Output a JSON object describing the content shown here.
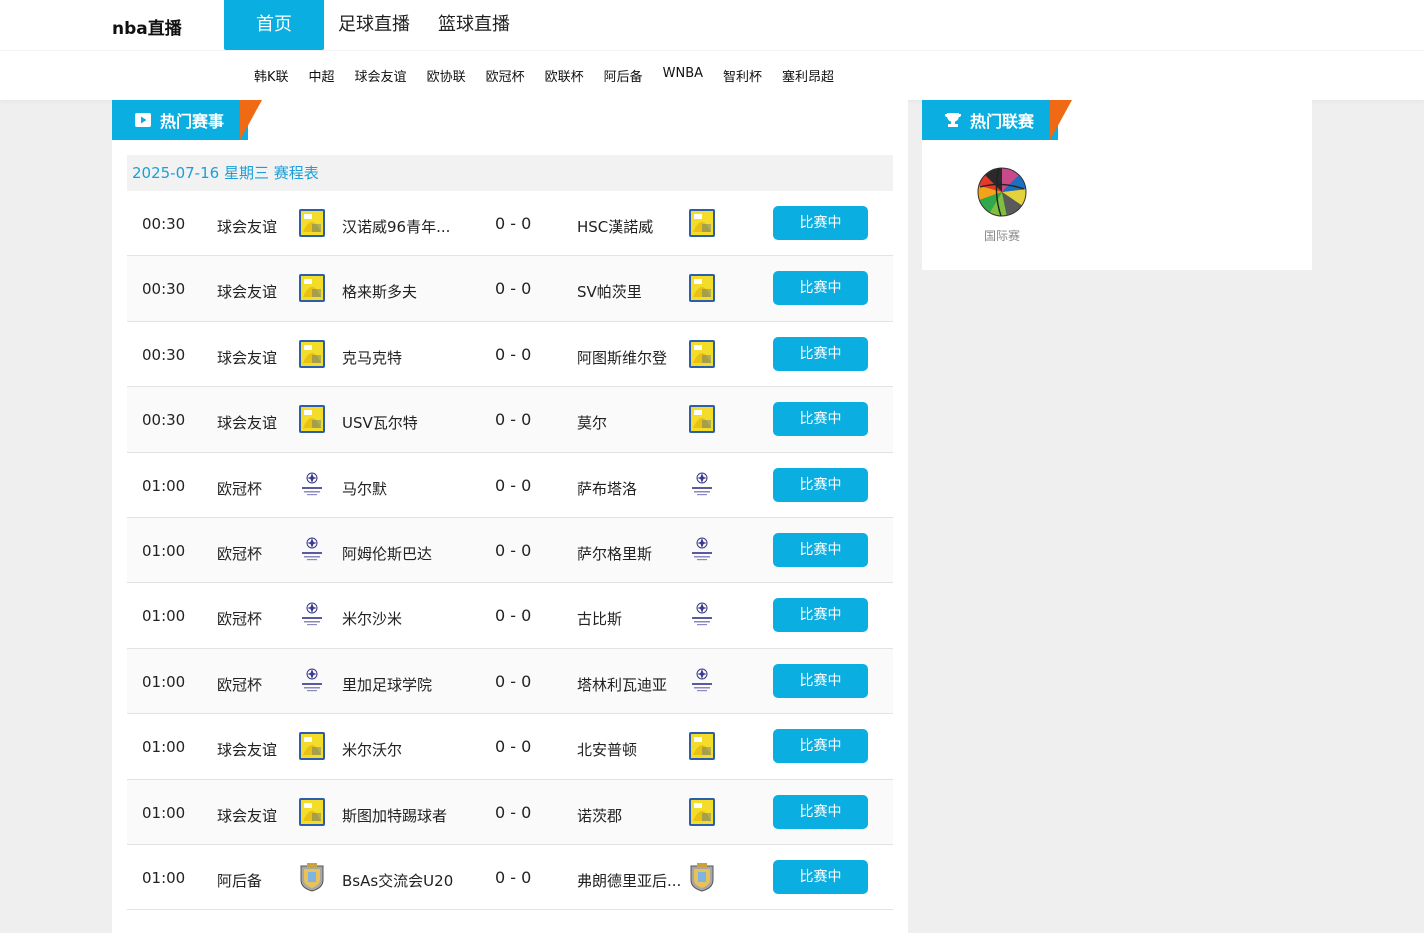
{
  "header": {
    "logo": "nba直播",
    "nav": [
      "首页",
      "足球直播",
      "篮球直播"
    ],
    "subnav": [
      "韩K联",
      "中超",
      "球会友谊",
      "欧协联",
      "欧冠杯",
      "欧联杯",
      "阿后备",
      "WNBA",
      "智利杯",
      "塞利昂超"
    ]
  },
  "colors": {
    "accent": "#0aaee0",
    "tab_tail": "#f06a16"
  },
  "left": {
    "section_title": "热门赛事",
    "section_icon": "play-icon",
    "date_line": "2025-07-16 星期三 赛程表",
    "matches": [
      {
        "time": "00:30",
        "league": "球会友谊",
        "home": "汉诺威96青年...",
        "score": "0 - 0",
        "away": "HSC漢諾威",
        "logo": "friendly-badge-icon",
        "status": "比赛中"
      },
      {
        "time": "00:30",
        "league": "球会友谊",
        "home": "格来斯多夫",
        "score": "0 - 0",
        "away": "SV帕茨里",
        "logo": "friendly-badge-icon",
        "status": "比赛中"
      },
      {
        "time": "00:30",
        "league": "球会友谊",
        "home": "克马克特",
        "score": "0 - 0",
        "away": "阿图斯维尔登",
        "logo": "friendly-badge-icon",
        "status": "比赛中"
      },
      {
        "time": "00:30",
        "league": "球会友谊",
        "home": "USV瓦尔特",
        "score": "0 - 0",
        "away": "莫尔",
        "logo": "friendly-badge-icon",
        "status": "比赛中"
      },
      {
        "time": "01:00",
        "league": "欧冠杯",
        "home": "马尔默",
        "score": "0 - 0",
        "away": "萨布塔洛",
        "logo": "champions-league-icon",
        "status": "比赛中"
      },
      {
        "time": "01:00",
        "league": "欧冠杯",
        "home": "阿姆伦斯巴达",
        "score": "0 - 0",
        "away": "萨尔格里斯",
        "logo": "champions-league-icon",
        "status": "比赛中"
      },
      {
        "time": "01:00",
        "league": "欧冠杯",
        "home": "米尔沙米",
        "score": "0 - 0",
        "away": "古比斯",
        "logo": "champions-league-icon",
        "status": "比赛中"
      },
      {
        "time": "01:00",
        "league": "欧冠杯",
        "home": "里加足球学院",
        "score": "0 - 0",
        "away": "塔林利瓦迪亚",
        "logo": "champions-league-icon",
        "status": "比赛中"
      },
      {
        "time": "01:00",
        "league": "球会友谊",
        "home": "米尔沃尔",
        "score": "0 - 0",
        "away": "北安普顿",
        "logo": "friendly-badge-icon",
        "status": "比赛中"
      },
      {
        "time": "01:00",
        "league": "球会友谊",
        "home": "斯图加特踢球者",
        "score": "0 - 0",
        "away": "诺茨郡",
        "logo": "friendly-badge-icon",
        "status": "比赛中"
      },
      {
        "time": "01:00",
        "league": "阿后备",
        "home": "BsAs交流会U20",
        "score": "0 - 0",
        "away": "弗朗德里亚后...",
        "logo": "argentina-badge-icon",
        "status": "比赛中"
      }
    ]
  },
  "right": {
    "section_title": "热门联赛",
    "section_icon": "trophy-icon",
    "leagues": [
      {
        "name": "国际赛",
        "icon": "basketball-globe-icon"
      }
    ]
  }
}
